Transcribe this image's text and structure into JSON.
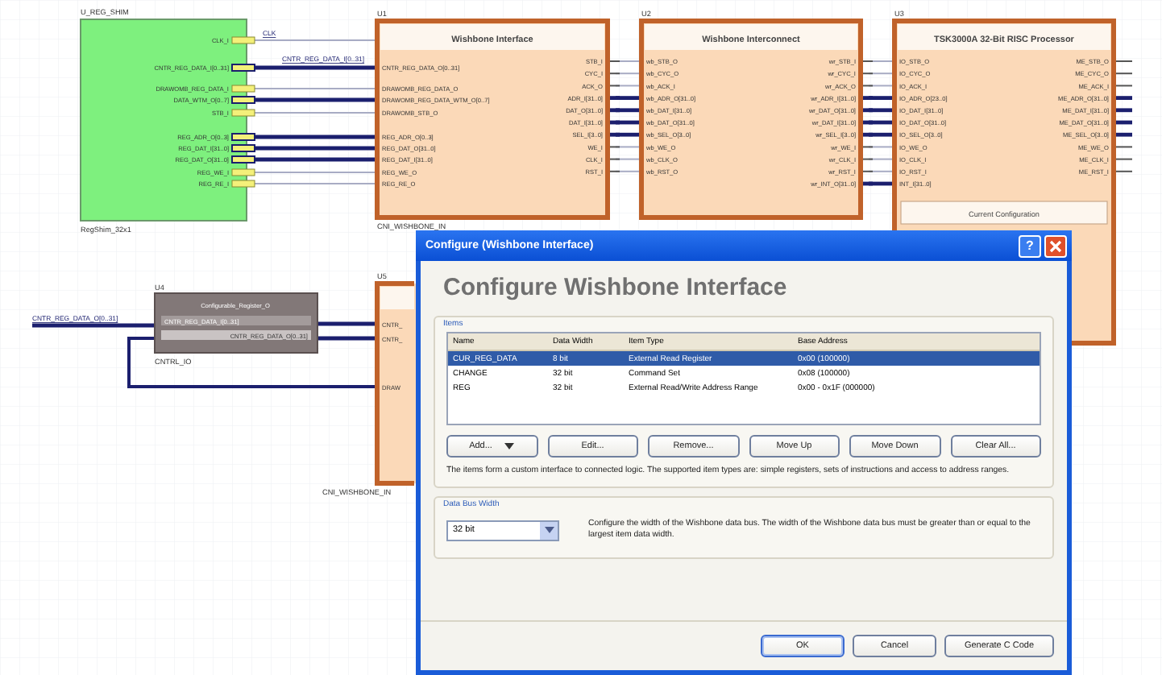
{
  "schematic": {
    "blocks": [
      {
        "kind": "shim",
        "designator": "U_REG_SHIM",
        "footer": "RegShim_32x1",
        "right_pins": [
          {
            "label": "CLK_I",
            "bus": false
          },
          {
            "label": "CNTR_REG_DATA_I[0..31]",
            "bus": true
          },
          {
            "label": "DRAWOMB_REG_DATA_I",
            "bus": false
          },
          {
            "label": "DATA_WTM_O[0..7]",
            "bus": true
          },
          {
            "label": "STB_I",
            "bus": false
          },
          {
            "label": "REG_ADR_O[0..3]",
            "bus": true
          },
          {
            "label": "REG_DAT_I[31..0]",
            "bus": true
          },
          {
            "label": "REG_DAT_O[31..0]",
            "bus": true
          },
          {
            "label": "REG_WE_I",
            "bus": false
          },
          {
            "label": "REG_RE_I",
            "bus": false
          }
        ]
      },
      {
        "kind": "core",
        "designator": "U1",
        "title": "Wishbone Interface",
        "footer": "CNI_WISHBONE_IN",
        "left_pins": [
          "CNTR_REG_DATA_O[0..31]",
          "DRAWOMB_REG_DATA_O",
          "DRAWOMB_REG_DATA_WTM_O[0..7]",
          "DRAWOMB_STB_O",
          "REG_ADR_O[0..3]",
          "REG_DAT_O[31..0]",
          "REG_DAT_I[31..0]",
          "REG_WE_O",
          "REG_RE_O"
        ],
        "right_pins": [
          {
            "label": "STB_I",
            "bus": false
          },
          {
            "label": "CYC_I",
            "bus": false
          },
          {
            "label": "ACK_O",
            "bus": false
          },
          {
            "label": "ADR_I[31..0]",
            "bus": true
          },
          {
            "label": "DAT_O[31..0]",
            "bus": true
          },
          {
            "label": "DAT_I[31..0]",
            "bus": true
          },
          {
            "label": "SEL_I[3..0]",
            "bus": true
          },
          {
            "label": "WE_I",
            "bus": false
          },
          {
            "label": "CLK_I",
            "bus": false
          },
          {
            "label": "RST_I",
            "bus": false
          }
        ]
      },
      {
        "kind": "core",
        "designator": "U2",
        "title": "Wishbone Interconnect",
        "left_pins": [
          "wb_STB_O",
          "wb_CYC_O",
          "wb_ACK_I",
          "wb_ADR_O[31..0]",
          "wb_DAT_I[31..0]",
          "wb_DAT_O[31..0]",
          "wb_SEL_O[3..0]",
          "wb_WE_O",
          "wb_CLK_O",
          "wb_RST_O"
        ],
        "right_pins": [
          {
            "label": "wr_STB_I",
            "bus": false
          },
          {
            "label": "wr_CYC_I",
            "bus": false
          },
          {
            "label": "wr_ACK_O",
            "bus": false
          },
          {
            "label": "wr_ADR_I[31..0]",
            "bus": true
          },
          {
            "label": "wr_DAT_O[31..0]",
            "bus": true
          },
          {
            "label": "wr_DAT_I[31..0]",
            "bus": true
          },
          {
            "label": "wr_SEL_I[3..0]",
            "bus": true
          },
          {
            "label": "wr_WE_I",
            "bus": false
          },
          {
            "label": "wr_CLK_I",
            "bus": false
          },
          {
            "label": "wr_RST_I",
            "bus": false
          },
          {
            "label": "wr_INT_O[31..0]",
            "bus": true
          }
        ]
      },
      {
        "kind": "core",
        "designator": "U3",
        "title": "TSK3000A 32-Bit RISC Processor",
        "left_pins": [
          "IO_STB_O",
          "IO_CYC_O",
          "IO_ACK_I",
          "IO_ADR_O[23..0]",
          "IO_DAT_I[31..0]",
          "IO_DAT_O[31..0]",
          "IO_SEL_O[3..0]",
          "IO_WE_O",
          "IO_CLK_I",
          "IO_RST_I",
          "INT_I[31..0]"
        ],
        "right_pins": [
          {
            "label": "ME_STB_O",
            "bus": false
          },
          {
            "label": "ME_CYC_O",
            "bus": false
          },
          {
            "label": "ME_ACK_I",
            "bus": false
          },
          {
            "label": "ME_ADR_O[31..0]",
            "bus": true
          },
          {
            "label": "ME_DAT_I[31..0]",
            "bus": true
          },
          {
            "label": "ME_DAT_O[31..0]",
            "bus": true
          },
          {
            "label": "ME_SEL_O[3..0]",
            "bus": true
          },
          {
            "label": "ME_WE_O",
            "bus": false
          },
          {
            "label": "ME_CLK_I",
            "bus": false
          },
          {
            "label": "ME_RST_I",
            "bus": false
          }
        ],
        "section": "Current Configuration"
      }
    ],
    "net_labels": [
      "CLK",
      "CNTR_REG_DATA_I[0..31]",
      "CNTR_REG_DATA_O[0..31]"
    ],
    "register": {
      "designator": "U4",
      "title": "Configurable_Register_O",
      "footer": "CNTRL_IO",
      "pins": [
        "CNTR_REG_DATA_I[0..31]",
        "CNTR_REG_DATA_O[0..31]"
      ]
    },
    "lower_block": {
      "designator": "U5",
      "footer": "CNI_WISHBONE_IN",
      "pins": [
        "CNTR_",
        "CNTR_",
        "DRAW"
      ]
    }
  },
  "dialog": {
    "title": "Configure  (Wishbone Interface)",
    "help": "?",
    "heading": "Configure Wishbone Interface",
    "items_group": "Items",
    "columns": [
      "Name",
      "Data Width",
      "Item Type",
      "Base Address"
    ],
    "rows": [
      {
        "cells": [
          "CUR_REG_DATA",
          "8 bit",
          "External Read Register",
          "0x00 (100000)"
        ],
        "selected": true
      },
      {
        "cells": [
          "CHANGE",
          "32 bit",
          "Command Set",
          "0x08 (100000)"
        ],
        "selected": false
      },
      {
        "cells": [
          "REG",
          "32 bit",
          "External Read/Write Address Range",
          "0x00 - 0x1F (000000)"
        ],
        "selected": false
      }
    ],
    "item_buttons": [
      "Add...",
      "Edit...",
      "Remove...",
      "Move Up",
      "Move Down",
      "Clear All..."
    ],
    "items_note": "The items form a custom interface to connected logic. The supported item types are: simple registers, sets of instructions and access to address ranges.",
    "bus_group": "Data Bus Width",
    "bus_width": "32 bit",
    "bus_note": "Configure the width of the Wishbone data bus. The width of the Wishbone data bus must be greater than or equal to the largest item data width.",
    "footer_buttons": [
      "OK",
      "Cancel",
      "Generate C Code"
    ]
  }
}
